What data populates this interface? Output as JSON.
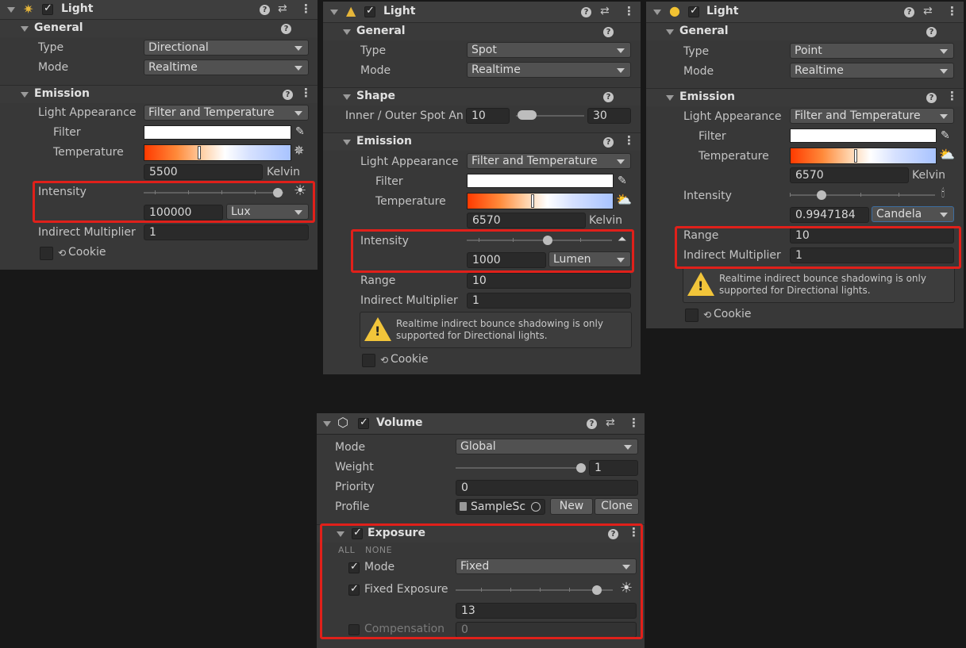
{
  "panel_dir": {
    "title": "Light",
    "general": {
      "header": "General",
      "type_label": "Type",
      "type_value": "Directional",
      "mode_label": "Mode",
      "mode_value": "Realtime"
    },
    "emission": {
      "header": "Emission",
      "appearance_label": "Light Appearance",
      "appearance_value": "Filter and Temperature",
      "filter_label": "Filter",
      "filter_color": "#ffffff",
      "temperature_label": "Temperature",
      "temperature_value": "5500",
      "temperature_unit": "Kelvin",
      "intensity_label": "Intensity",
      "intensity_value": "100000",
      "intensity_unit": "Lux",
      "indirect_label": "Indirect Multiplier",
      "indirect_value": "1",
      "cookie_label": "Cookie"
    }
  },
  "panel_spot": {
    "title": "Light",
    "general": {
      "header": "General",
      "type_label": "Type",
      "type_value": "Spot",
      "mode_label": "Mode",
      "mode_value": "Realtime"
    },
    "shape": {
      "header": "Shape",
      "angle_label": "Inner / Outer Spot An",
      "inner_value": "10",
      "outer_value": "30"
    },
    "emission": {
      "header": "Emission",
      "appearance_label": "Light Appearance",
      "appearance_value": "Filter and Temperature",
      "filter_label": "Filter",
      "filter_color": "#ffffff",
      "temperature_label": "Temperature",
      "temperature_value": "6570",
      "temperature_unit": "Kelvin",
      "intensity_label": "Intensity",
      "intensity_value": "1000",
      "intensity_unit": "Lumen",
      "range_label": "Range",
      "range_value": "10",
      "indirect_label": "Indirect Multiplier",
      "indirect_value": "1",
      "warning_line1": "Realtime indirect bounce shadowing is only",
      "warning_line2": "supported for Directional lights.",
      "cookie_label": "Cookie"
    }
  },
  "panel_point": {
    "title": "Light",
    "general": {
      "header": "General",
      "type_label": "Type",
      "type_value": "Point",
      "mode_label": "Mode",
      "mode_value": "Realtime"
    },
    "emission": {
      "header": "Emission",
      "appearance_label": "Light Appearance",
      "appearance_value": "Filter and Temperature",
      "filter_label": "Filter",
      "filter_color": "#ffffff",
      "temperature_label": "Temperature",
      "temperature_value": "6570",
      "temperature_unit": "Kelvin",
      "intensity_label": "Intensity",
      "intensity_value": "0.9947184",
      "intensity_unit": "Candela",
      "range_label": "Range",
      "range_value": "10",
      "indirect_label": "Indirect Multiplier",
      "indirect_value": "1",
      "warning_line1": "Realtime indirect bounce shadowing is only",
      "warning_line2": "supported for Directional lights.",
      "cookie_label": "Cookie"
    }
  },
  "panel_volume": {
    "title": "Volume",
    "mode_label": "Mode",
    "mode_value": "Global",
    "weight_label": "Weight",
    "weight_value": "1",
    "priority_label": "Priority",
    "priority_value": "0",
    "profile_label": "Profile",
    "profile_value": "SampleSc",
    "new_label": "New",
    "clone_label": "Clone",
    "exposure": {
      "header": "Exposure",
      "all_label": "ALL",
      "none_label": "NONE",
      "mode_label": "Mode",
      "mode_value": "Fixed",
      "fixed_label": "Fixed Exposure",
      "fixed_value": "13",
      "compensation_label": "Compensation",
      "compensation_value": "0"
    }
  },
  "colors": {
    "highlight": "#e0201a",
    "warning": "#f2c53a",
    "panel_bg": "#383838",
    "page_bg": "#181818"
  },
  "icons": [
    "directional-light-icon",
    "spot-light-icon",
    "point-light-icon",
    "volume-cube-icon",
    "help-icon",
    "presets-icon",
    "kebab-menu-icon",
    "eyedropper-icon",
    "sun-icon",
    "cloud-sun-icon",
    "candle-icon",
    "warning-icon",
    "cookie-target-icon",
    "object-picker-icon"
  ]
}
